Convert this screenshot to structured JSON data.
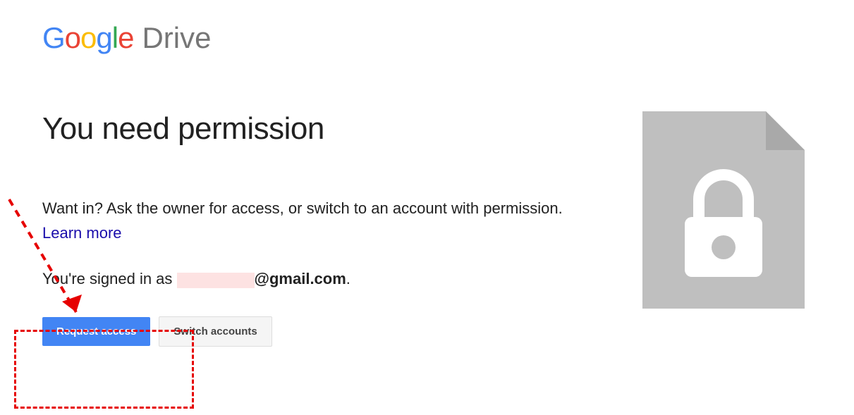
{
  "logo": {
    "google": "Google",
    "product": "Drive"
  },
  "heading": "You need permission",
  "description_prefix": "Want in? Ask the owner for access, or switch to an account with permission. ",
  "learn_more": "Learn more",
  "signed_in_prefix": "You're signed in as ",
  "email_suffix": "@gmail.com",
  "signed_in_period": ".",
  "buttons": {
    "request_access": "Request access",
    "switch_accounts": "Switch accounts"
  }
}
